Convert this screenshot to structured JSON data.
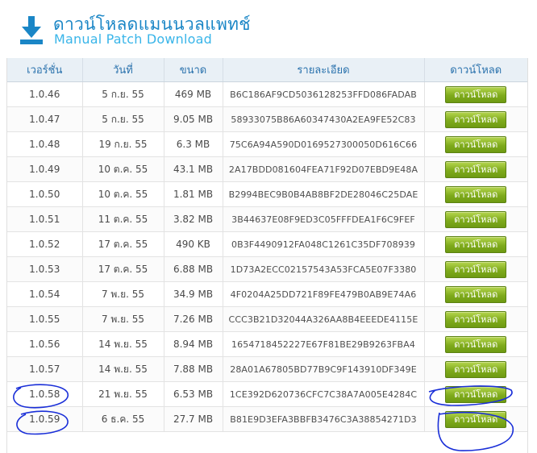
{
  "header": {
    "title_th": "ดาวน์โหลดแมนนวลแพทช์",
    "title_en": "Manual Patch Download",
    "icon": "download-arrow-icon"
  },
  "table": {
    "columns": [
      "เวอร์ชั่น",
      "วันที่",
      "ขนาด",
      "รายละเอียด",
      "ดาวน์โหลด"
    ],
    "rows": [
      {
        "version": "1.0.46",
        "date": "5 ก.ย. 55",
        "size": "469 MB",
        "detail": "B6C186AF9CD5036128253FFD086FADAB",
        "button": "ดาวน์โหลด"
      },
      {
        "version": "1.0.47",
        "date": "5 ก.ย. 55",
        "size": "9.05 MB",
        "detail": "58933075B86A60347430A2EA9FE52C83",
        "button": "ดาวน์โหลด"
      },
      {
        "version": "1.0.48",
        "date": "19 ก.ย. 55",
        "size": "6.3 MB",
        "detail": "75C6A94A590D0169527300050D616C66",
        "button": "ดาวน์โหลด"
      },
      {
        "version": "1.0.49",
        "date": "10 ต.ค. 55",
        "size": "43.1 MB",
        "detail": "2A17BDD081604FEA71F92D07EBD9E48A",
        "button": "ดาวน์โหลด"
      },
      {
        "version": "1.0.50",
        "date": "10 ต.ค. 55",
        "size": "1.81 MB",
        "detail": "B2994BEC9B0B4AB8BF2DE28046C25DAE",
        "button": "ดาวน์โหลด"
      },
      {
        "version": "1.0.51",
        "date": "11 ต.ค. 55",
        "size": "3.82 MB",
        "detail": "3B44637E08F9ED3C05FFFDEA1F6C9FEF",
        "button": "ดาวน์โหลด"
      },
      {
        "version": "1.0.52",
        "date": "17 ต.ค. 55",
        "size": "490 KB",
        "detail": "0B3F4490912FA048C1261C35DF708939",
        "button": "ดาวน์โหลด"
      },
      {
        "version": "1.0.53",
        "date": "17 ต.ค. 55",
        "size": "6.88 MB",
        "detail": "1D73A2ECC02157543A53FCA5E07F3380",
        "button": "ดาวน์โหลด"
      },
      {
        "version": "1.0.54",
        "date": "7 พ.ย. 55",
        "size": "34.9 MB",
        "detail": "4F0204A25DD721F89FE479B0AB9E74A6",
        "button": "ดาวน์โหลด"
      },
      {
        "version": "1.0.55",
        "date": "7 พ.ย. 55",
        "size": "7.26 MB",
        "detail": "CCC3B21D32044A326AA8B4EEEDE4115E",
        "button": "ดาวน์โหลด"
      },
      {
        "version": "1.0.56",
        "date": "14 พ.ย. 55",
        "size": "8.94 MB",
        "detail": "1654718452227E67F81BE29B9263FBA4",
        "button": "ดาวน์โหลด"
      },
      {
        "version": "1.0.57",
        "date": "14 พ.ย. 55",
        "size": "7.88 MB",
        "detail": "28A01A67805BD77B9C9F143910DF349E",
        "button": "ดาวน์โหลด"
      },
      {
        "version": "1.0.58",
        "date": "21 พ.ย. 55",
        "size": "6.53 MB",
        "detail": "1CE392D620736CFC7C38A7A005E4284C",
        "button": "ดาวน์โหลด"
      },
      {
        "version": "1.0.59",
        "date": "6 ธ.ค. 55",
        "size": "27.7 MB",
        "detail": "B81E9D3EFA3BBFB3476C3A38854271D3",
        "button": "ดาวน์โหลด"
      }
    ]
  },
  "annotations": {
    "color": "#1a2fd8",
    "circled_rows": [
      "1.0.58",
      "1.0.59"
    ]
  },
  "colors": {
    "title": "#1a86c6",
    "subtitle": "#39b5e9",
    "header_text": "#2a72ad",
    "button": "#7fab1c"
  }
}
